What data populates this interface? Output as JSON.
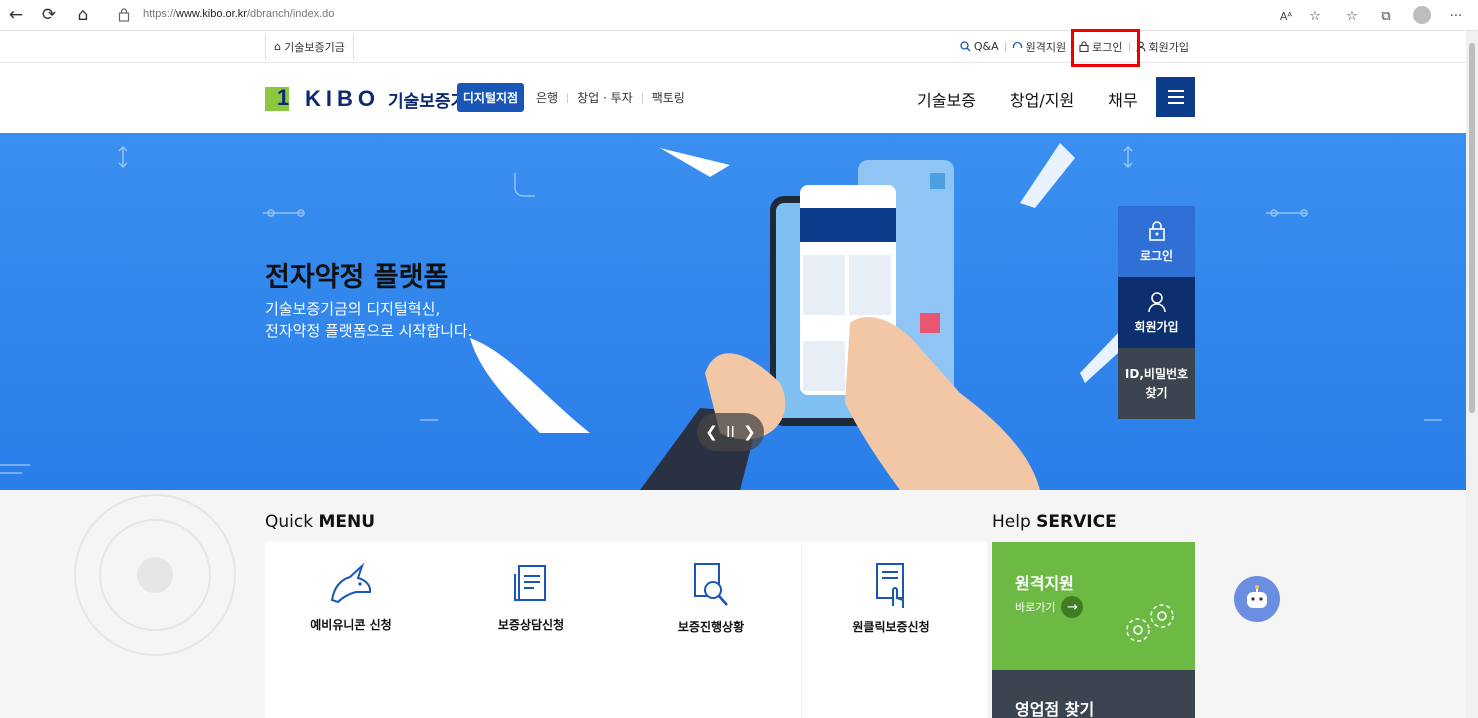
{
  "browser": {
    "url_prefix": "https://",
    "url_host": "www.kibo.or.kr",
    "url_path": "/dbranch/index.do"
  },
  "util": {
    "home_label": "기술보증기금",
    "links": [
      "Q&A",
      "원격지원",
      "로그인",
      "회원가입"
    ]
  },
  "header": {
    "logo_text": "KIBO",
    "logo_kor": "기술보증기금",
    "digital_tag": "디지털지점",
    "subnav": [
      "은행",
      "창업 · 투자",
      "팩토링"
    ],
    "mainnav": [
      "기술보증",
      "창업/지원",
      "채무"
    ]
  },
  "hero": {
    "title": "전자약정 플랫폼",
    "sub_line1": "기술보증기금의 디지털혁신,",
    "sub_line2": "전자약정 플랫폼으로 시작합니다.",
    "side": {
      "login": "로그인",
      "join": "회원가입",
      "find_line1": "ID,비밀번호",
      "find_line2": "찾기"
    }
  },
  "quick": {
    "title_light": "Quick ",
    "title_bold": "MENU",
    "items": [
      "예비유니콘 신청",
      "보증상담신청",
      "보증진행상황",
      "원클릭보증신청"
    ]
  },
  "help": {
    "title_light": "Help ",
    "title_bold": "SERVICE",
    "remote": "원격지원",
    "go": "바로가기",
    "branch": "영업점 찾기"
  },
  "colors": {
    "accent": "#1a56b8",
    "hero_bg": "#2f86ec",
    "green": "#6cb943",
    "navy": "#0d2f6e"
  }
}
